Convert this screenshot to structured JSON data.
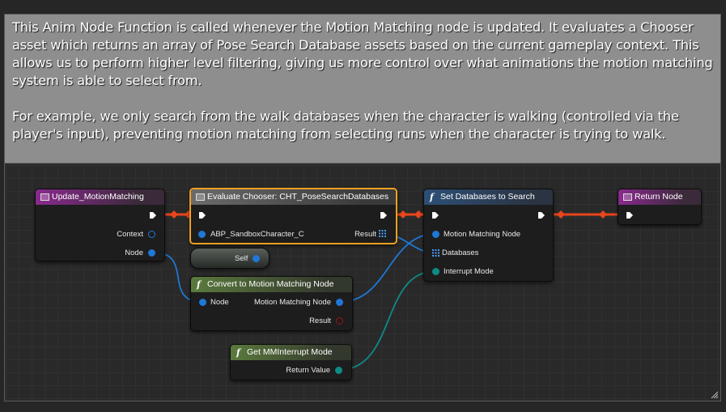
{
  "comment": {
    "text": "This Anim Node Function is called whenever the Motion Matching node is updated. It evaluates a Chooser asset which returns an array of Pose Search Database assets based on the current gameplay context. This allows us to perform higher level filtering, giving us more control over what animations the motion matching system is able to select from.\n\nFor example, we only search from the walk databases when the character is walking (controlled via the player's input), preventing motion matching from selecting runs when the character is trying to walk."
  },
  "nodes": {
    "update_mm": {
      "title": "Update_MotionMatching",
      "pins": {
        "context": "Context",
        "node": "Node"
      }
    },
    "evaluate_chooser": {
      "title": "Evaluate Chooser: CHT_PoseSearchDatabases",
      "pins": {
        "context_object": "ABP_SandboxCharacter_C",
        "result": "Result"
      }
    },
    "self": {
      "label": "Self"
    },
    "set_databases": {
      "title": "Set Databases to Search",
      "pins": {
        "mm_node": "Motion Matching Node",
        "databases": "Databases",
        "interrupt": "Interrupt Mode"
      }
    },
    "return_node": {
      "title": "Return Node"
    },
    "convert": {
      "title": "Convert to Motion Matching Node",
      "pins": {
        "node": "Node",
        "mm_node": "Motion Matching Node",
        "result": "Result"
      }
    },
    "get_interrupt": {
      "title": "Get MMInterrupt Mode",
      "pins": {
        "return_value": "Return Value"
      }
    }
  },
  "colors": {
    "exec_wire": "#e8451c",
    "object_pin": "#1f78d6",
    "struct_pin": "#0f8a86",
    "result_pin": "#a0131a",
    "selection": "#f0a020",
    "comment_bg": "#8e8e8e"
  },
  "icons": {
    "event": "event-node-icon",
    "function": "function-f-icon",
    "array": "array-grid-icon",
    "resize": "resize-grip-icon"
  }
}
